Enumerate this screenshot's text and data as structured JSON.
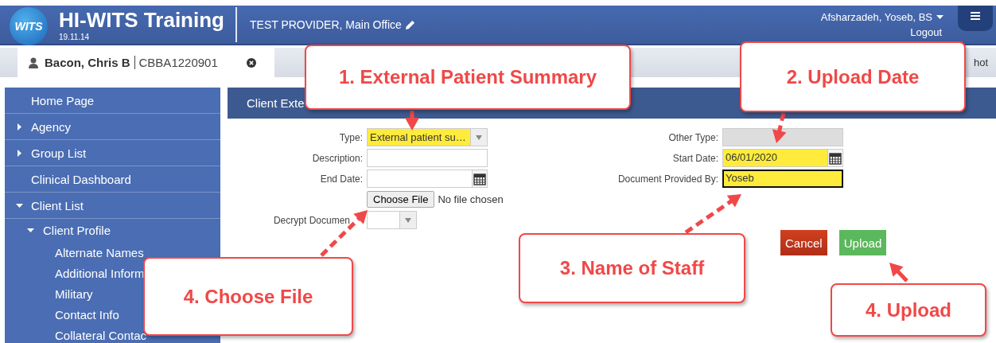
{
  "header": {
    "logo_text": "WITS",
    "title": "HI-WITS Training",
    "version": "19.11.14",
    "provider": "TEST PROVIDER, Main Office",
    "user": "Afsharzadeh, Yoseb, BS",
    "logout": "Logout"
  },
  "client_tab": {
    "name": "Bacon, Chris B",
    "id": "CBBA1220901",
    "selected": true
  },
  "tab_bar_text": "hot",
  "sidebar": {
    "items": [
      {
        "label": "Home Page"
      },
      {
        "label": "Agency",
        "expanded": false
      },
      {
        "label": "Group List",
        "expanded": false
      },
      {
        "label": "Clinical Dashboard"
      },
      {
        "label": "Client List",
        "expanded": true,
        "children": [
          {
            "label": "Client Profile",
            "expanded": true,
            "children": [
              {
                "label": "Alternate Names"
              },
              {
                "label": "Additional Inform"
              },
              {
                "label": "Military"
              },
              {
                "label": "Contact Info"
              },
              {
                "label": "Collateral Contac"
              }
            ]
          }
        ]
      }
    ]
  },
  "page_title": "Client Exte",
  "form": {
    "left": [
      {
        "kind": "select",
        "label": "Type:",
        "value": "External patient su…",
        "highlighted": true
      },
      {
        "kind": "text",
        "label": "Description:",
        "highlighted": false
      },
      {
        "kind": "date",
        "label": "End Date:",
        "highlighted": false
      },
      {
        "kind": "file",
        "button": "Choose File",
        "status": "No file chosen"
      },
      {
        "kind": "small_select",
        "label": "Decrypt Documen",
        "highlighted": false
      }
    ],
    "right": [
      {
        "kind": "text",
        "label": "Other Type:",
        "disabled": true,
        "highlighted": false
      },
      {
        "kind": "date",
        "label": "Start Date:",
        "value": "06/01/2020",
        "highlighted": true
      },
      {
        "kind": "text",
        "label": "Document Provided By:",
        "value": "Yoseb",
        "highlighted": true,
        "focused": true
      }
    ]
  },
  "buttons": [
    {
      "kind": "cancel",
      "label": "Cancel"
    },
    {
      "kind": "upload",
      "label": "Upload"
    }
  ],
  "callouts": [
    {
      "text": "1. External Patient Summary"
    },
    {
      "text": "2. Upload Date"
    },
    {
      "text": "3. Name of Staff"
    },
    {
      "text": "4. Choose File"
    },
    {
      "text": "4. Upload"
    }
  ]
}
